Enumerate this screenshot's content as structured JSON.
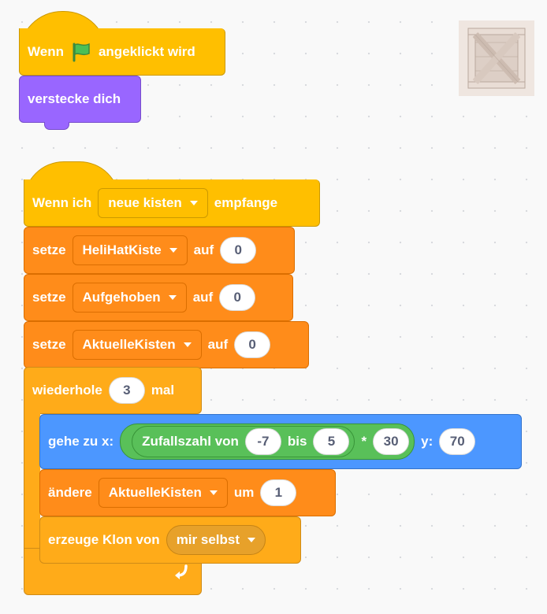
{
  "script1": {
    "hat": {
      "prefix": "Wenn",
      "flag_icon": "green-flag-icon",
      "suffix": "angeklickt wird"
    },
    "hide": {
      "label": "verstecke dich"
    }
  },
  "sprite_thumbnail": {
    "icon": "wooden-crate-icon"
  },
  "script2": {
    "hat": {
      "prefix": "Wenn ich",
      "message": "neue kisten",
      "suffix": "empfange"
    },
    "set1": {
      "label": "setze",
      "variable": "HeliHatKiste",
      "to": "auf",
      "value": "0"
    },
    "set2": {
      "label": "setze",
      "variable": "Aufgehoben",
      "to": "auf",
      "value": "0"
    },
    "set3": {
      "label": "setze",
      "variable": "AktuelleKisten",
      "to": "auf",
      "value": "0"
    },
    "repeat": {
      "label": "wiederhole",
      "times": "3",
      "suffix": "mal",
      "loop_icon": "loop-arrow-icon"
    },
    "goto": {
      "label": "gehe zu x:",
      "y_label": "y:",
      "y_value": "70",
      "expr": {
        "random_label": "Zufallszahl von",
        "from": "-7",
        "to_label": "bis",
        "to": "5",
        "operator": "*",
        "multiplier": "30"
      }
    },
    "change": {
      "label": "ändere",
      "variable": "AktuelleKisten",
      "by": "um",
      "value": "1"
    },
    "clone": {
      "label": "erzeuge Klon von",
      "target": "mir selbst"
    }
  },
  "colors": {
    "events": "#ffbf00",
    "looks": "#9966ff",
    "variables": "#ff8c1a",
    "control": "#ffab19",
    "motion": "#4c97ff",
    "operators": "#59c059"
  }
}
